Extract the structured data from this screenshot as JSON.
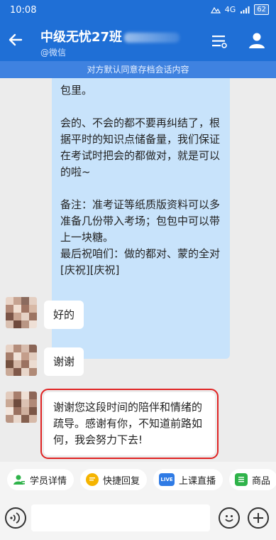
{
  "status_bar": {
    "time": "10:08",
    "battery": "62",
    "network": "4G"
  },
  "header": {
    "title": "中级无忧27班",
    "subtitle": "@微信"
  },
  "notice": "对方默认同意存档会话内容",
  "chat": {
    "outgoing": {
      "paragraphs": [
        "包里。",
        "会的、不会的都不要再纠结了，根据平时的知识点储备量，我们保证在考试时把会的都做对，就是可以的啦~",
        "备注：准考证等纸质版资料可以多准备几份带入考场；包包中可以带上一块糖。",
        "最后祝咱们：做的都对、蒙的全对[庆祝][庆祝]"
      ]
    },
    "incoming": [
      {
        "text": "好的"
      },
      {
        "text": "谢谢"
      },
      {
        "text": "谢谢您这段时间的陪伴和情绪的疏导。感谢有你，不知道前路如何，我会努力下去!"
      }
    ]
  },
  "quick_actions": [
    {
      "label": "学员详情",
      "icon": "person-icon",
      "color": "#2fb34a"
    },
    {
      "label": "快捷回复",
      "icon": "chat-icon",
      "color": "#f5b400"
    },
    {
      "label": "上课直播",
      "icon": "live-icon",
      "color": "#2f7be5",
      "badge": "LIVE"
    },
    {
      "label": "商品",
      "icon": "product-icon",
      "color": "#2fb34a"
    }
  ],
  "input": {
    "placeholder": ""
  },
  "colors": {
    "brand_blue": "#1f6fd6",
    "notice_blue": "#3f82e0",
    "outgoing_bubble": "#c8e3fb",
    "highlight_border": "#e02424"
  }
}
